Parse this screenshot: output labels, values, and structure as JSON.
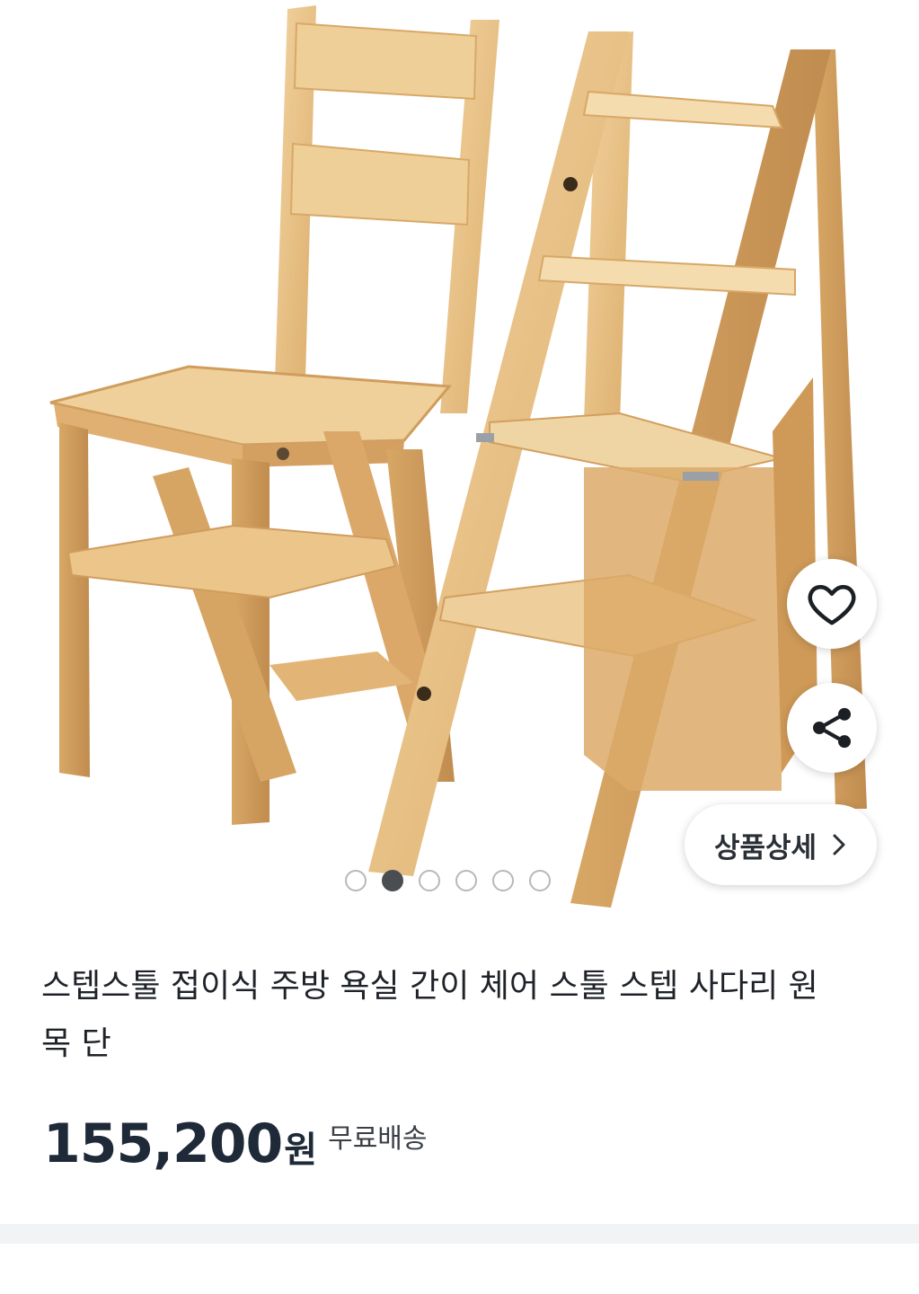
{
  "product": {
    "image_alt": "wooden folding step stool chair",
    "title": "스텝스툴 접이식 주방 욕실 간이 체어 스툴 스텝 사다리 원목 단",
    "price": "155,200",
    "currency": "원",
    "shipping": "무료배송"
  },
  "gallery": {
    "total": 6,
    "active_index": 2
  },
  "actions": {
    "like_icon": "heart-icon",
    "share_icon": "share-icon",
    "detail_label": "상품상세",
    "detail_icon": "chevron-right-icon"
  },
  "colors": {
    "wood": "#e9c48a",
    "wood_dark": "#c8965a",
    "text": "#1f2329"
  }
}
